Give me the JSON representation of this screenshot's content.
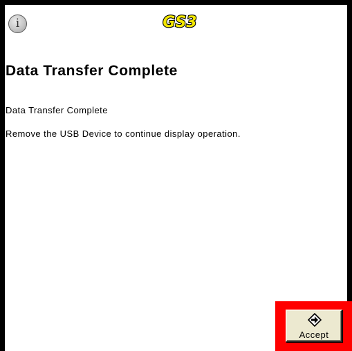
{
  "header": {
    "info_icon": "info-icon",
    "info_glyph": "i",
    "logo_text": "GS3",
    "logo_color": "#f2e600"
  },
  "dialog": {
    "title": "Data Transfer Complete",
    "message_1": "Data Transfer Complete",
    "message_2": "Remove the USB Device to continue display operation."
  },
  "actions": {
    "accept_label": "Accept",
    "accept_icon": "arrow-enter-icon",
    "highlight_color": "#ff0000"
  }
}
